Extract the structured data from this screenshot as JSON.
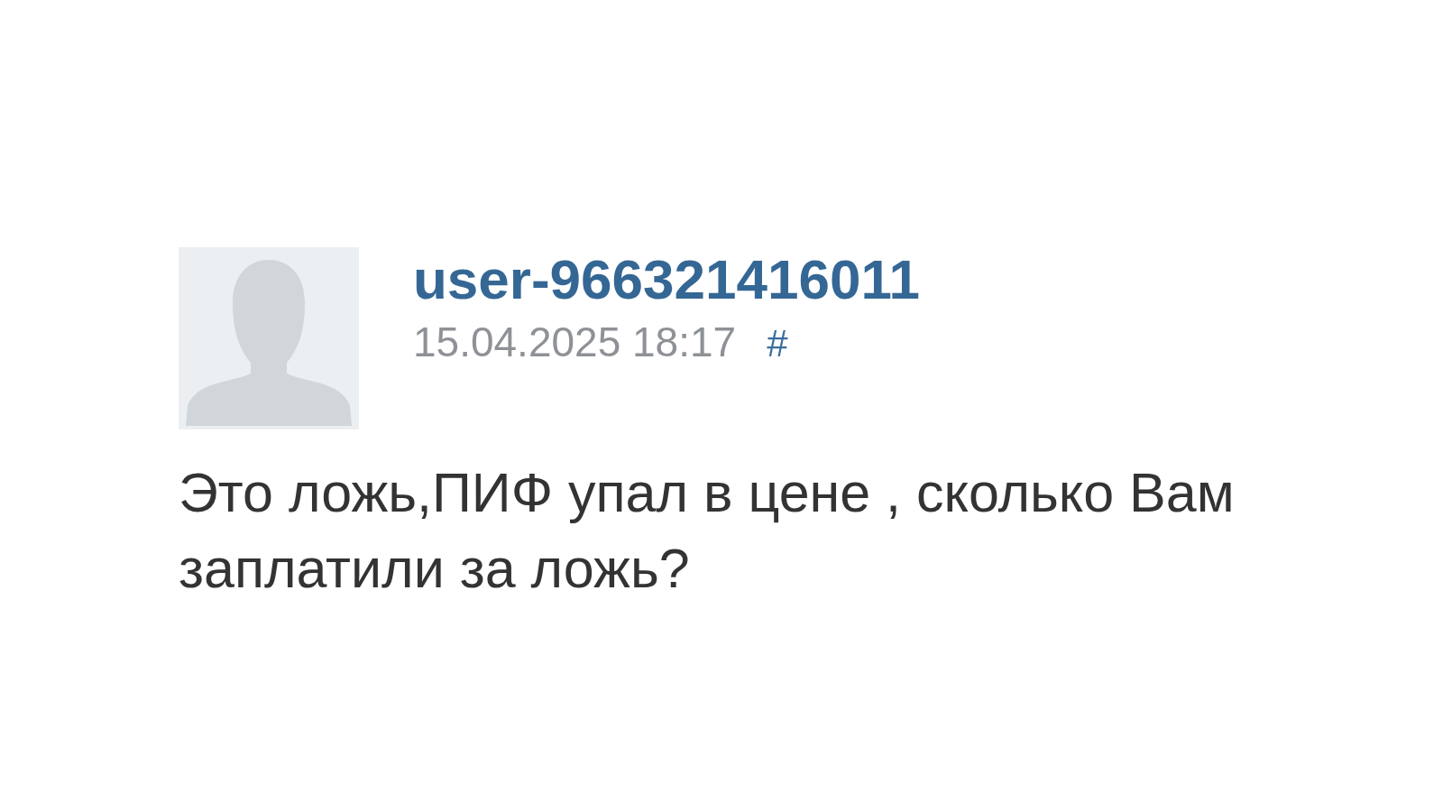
{
  "comment": {
    "author": "user-966321416011",
    "date": "15.04.2025 18:17",
    "permalink": "#",
    "text": "Это ложь,ПИФ упал в цене , сколько Вам заплатили за ложь?"
  }
}
